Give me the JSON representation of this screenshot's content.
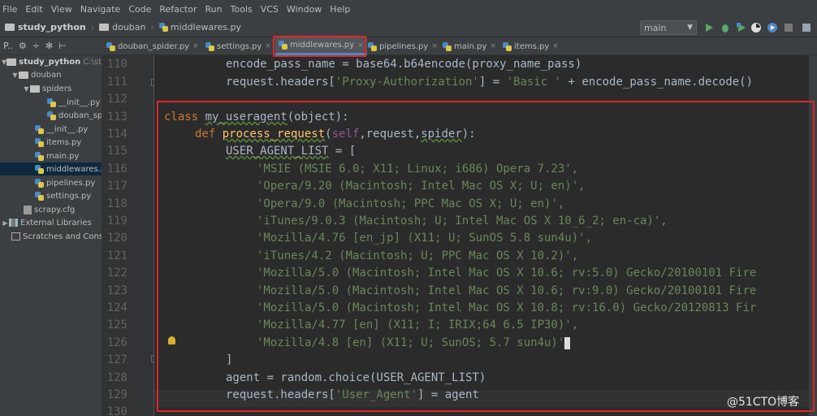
{
  "menu": [
    "File",
    "Edit",
    "View",
    "Navigate",
    "Code",
    "Refactor",
    "Run",
    "Tools",
    "VCS",
    "Window",
    "Help"
  ],
  "breadcrumb": {
    "project": "study_python",
    "folder": "douban",
    "file": "middlewares.py"
  },
  "run_config": "main",
  "project_toolbar": [
    "P..",
    "⚙",
    "÷",
    "✻",
    "⊢"
  ],
  "tree": [
    {
      "label": "study_python",
      "muted": "C:\\stu",
      "icon": "folder-icon",
      "bold": true
    },
    {
      "label": "douban",
      "icon": "folder-icon"
    },
    {
      "label": "spiders",
      "icon": "folder-icon"
    },
    {
      "label": "__init__.py",
      "icon": "python-file-icon"
    },
    {
      "label": "douban_spi",
      "icon": "python-file-icon"
    },
    {
      "label": "__init__.py",
      "icon": "python-file-icon"
    },
    {
      "label": "items.py",
      "icon": "python-file-icon"
    },
    {
      "label": "main.py",
      "icon": "python-file-icon"
    },
    {
      "label": "middlewares.p",
      "icon": "python-file-icon",
      "selected": true
    },
    {
      "label": "pipelines.py",
      "icon": "python-file-icon"
    },
    {
      "label": "settings.py",
      "icon": "python-file-icon"
    },
    {
      "label": "scrapy.cfg",
      "icon": "config-file-icon"
    },
    {
      "label": "External Libraries",
      "icon": "library-icon"
    },
    {
      "label": "Scratches and Consc",
      "icon": "scratches-icon"
    }
  ],
  "tabs": [
    {
      "label": "douban_spider.py"
    },
    {
      "label": "settings.py"
    },
    {
      "label": "middlewares.py",
      "active": true
    },
    {
      "label": "pipelines.py"
    },
    {
      "label": "main.py"
    },
    {
      "label": "items.py"
    }
  ],
  "line_numbers": [
    "110",
    "111",
    "112",
    "113",
    "114",
    "115",
    "116",
    "117",
    "118",
    "119",
    "120",
    "121",
    "122",
    "123",
    "124",
    "125",
    "126",
    "127",
    "128",
    "129",
    "130"
  ],
  "code": {
    "l110_a": "encode_pass_name = base64.b64encode(proxy_name_pass)",
    "l111_a": "request.headers[",
    "l111_b": "'Proxy-Authorization'",
    "l111_c": "] = ",
    "l111_d": "'Basic '",
    "l111_e": " + encode_pass_name.decode()",
    "l113_a": "class ",
    "l113_b": "my_useragent",
    "l113_c": "(object):",
    "l114_a": "def ",
    "l114_b": "process_request",
    "l114_c": "(",
    "l114_d": "self",
    "l114_e": ",request,",
    "l114_f": "spider",
    "l114_g": "):",
    "l115_a": "USER_AGENT_LIST",
    "l115_b": " = [",
    "ua": [
      "'MSIE (MSIE 6.0; X11; Linux; i686) Opera 7.23',",
      "'Opera/9.20 (Macintosh; Intel Mac OS X; U; en)',",
      "'Opera/9.0 (Macintosh; PPC Mac OS X; U; en)',",
      "'iTunes/9.0.3 (Macintosh; U; Intel Mac OS X 10_6_2; en-ca)',",
      "'Mozilla/4.76 [en_jp] (X11; U; SunOS 5.8 sun4u)',",
      "'iTunes/4.2 (Macintosh; U; PPC Mac OS X 10.2)',",
      "'Mozilla/5.0 (Macintosh; Intel Mac OS X 10.6; rv:5.0) Gecko/20100101 Fire",
      "'Mozilla/5.0 (Macintosh; Intel Mac OS X 10.6; rv:9.0) Gecko/20100101 Fire",
      "'Mozilla/5.0 (Macintosh; Intel Mac OS X 10.8; rv:16.0) Gecko/20120813 Fir",
      "'Mozilla/4.77 [en] (X11; I; IRIX;64 6.5 IP30)',",
      "'Mozilla/4.8 [en] (X11; U; SunOS; 5.7 sun4u)'"
    ],
    "l127": "]",
    "l128": "agent = random.choice(USER_AGENT_LIST)",
    "l129_a": "request.headers[",
    "l129_b": "'User_Agent'",
    "l129_c": "] = agent"
  },
  "watermark": "@51CTO博客",
  "colors": {
    "highlight_box": "#e0242c",
    "keyword": "#cc7832",
    "string": "#6a8759",
    "function": "#ffc66d",
    "self": "#94558d"
  }
}
